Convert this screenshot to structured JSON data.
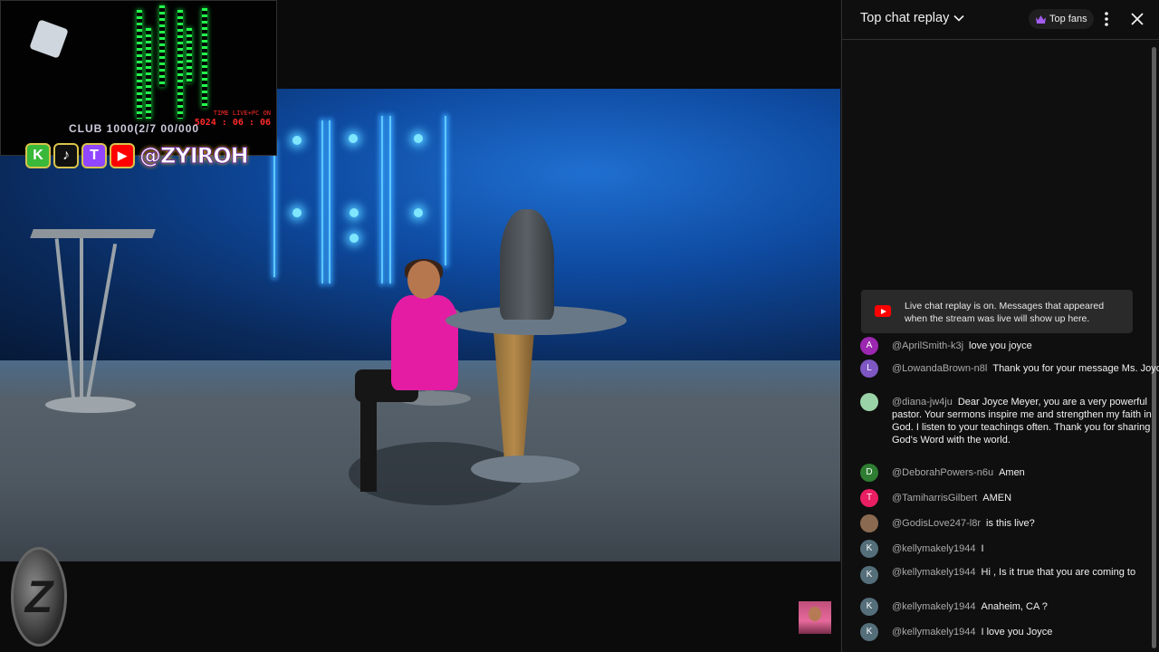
{
  "chat": {
    "title": "Top chat replay",
    "top_fans_label": "Top fans",
    "banner": "Live chat replay is on. Messages that appeared when the stream was live will show up here.",
    "messages": [
      {
        "author": "@AprilSmith-k3j",
        "text": "love you joyce",
        "avatar_letter": "A",
        "avatar_color": "#9c27b0"
      },
      {
        "author": "@LowandaBrown-n8l",
        "text": "Thank you for your message Ms. Joyce",
        "avatar_letter": "L",
        "avatar_color": "#7e57c2"
      },
      {
        "author": "@diana-jw4ju",
        "text": "Dear Joyce Meyer, you are a very powerful pastor. Your sermons inspire me and strengthen my faith in God. I listen to your teachings often. Thank you for sharing God's Word with the world.",
        "avatar_letter": "",
        "avatar_color": "#9ad3a7"
      },
      {
        "author": "@DeborahPowers-n6u",
        "text": "Amen",
        "avatar_letter": "D",
        "avatar_color": "#2e7d32"
      },
      {
        "author": "@TamiharrisGilbert",
        "text": "AMEN",
        "avatar_letter": "T",
        "avatar_color": "#e91e63"
      },
      {
        "author": "@GodisLove247-l8r",
        "text": "is this live?",
        "avatar_letter": "",
        "avatar_color": "#8a6a50"
      },
      {
        "author": "@kellymakely1944",
        "text": "I",
        "avatar_letter": "K",
        "avatar_color": "#546e7a"
      },
      {
        "author": "@kellymakely1944",
        "text": "Hi , Is it true that you are coming to",
        "avatar_letter": "K",
        "avatar_color": "#546e7a"
      },
      {
        "author": "@kellymakely1944",
        "text": "Anaheim, CA ?",
        "avatar_letter": "K",
        "avatar_color": "#546e7a"
      },
      {
        "author": "@kellymakely1944",
        "text": "I love you Joyce",
        "avatar_letter": "K",
        "avatar_color": "#546e7a"
      }
    ]
  },
  "overlay": {
    "social_handle": "@ZYIROH",
    "social_icons": [
      "K",
      "♪",
      "T",
      "▶"
    ],
    "stream_time_label": "TIME LIVE+PC ON",
    "stream_time_value": "5024 : 06 : 06",
    "webcam_strip": "CLUB 1000(2/7 00/000"
  },
  "colors": {
    "youtube_red": "#ff0000",
    "chat_bg": "#0f0f0f",
    "author_grey": "#aaaaaa",
    "crown_purple": "#a35cf0"
  }
}
